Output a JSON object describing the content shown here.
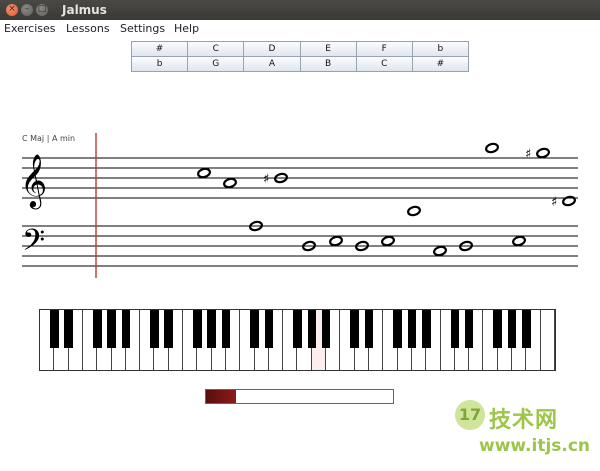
{
  "window": {
    "title": "Jalmus",
    "buttons": [
      "×",
      "–",
      "□"
    ]
  },
  "menu": [
    {
      "label": "Exercises"
    },
    {
      "label": "Lessons"
    },
    {
      "label": "Settings"
    },
    {
      "label": "Help"
    }
  ],
  "key_buttons": {
    "row1": [
      "#",
      "C",
      "D",
      "E",
      "F",
      "b"
    ],
    "row2": [
      "b",
      "G",
      "A",
      "B",
      "C",
      "#"
    ]
  },
  "staff": {
    "key_signature_label": "C Maj | A min",
    "cursor_color": "#c0392b",
    "treble_notes": [
      {
        "step": 1,
        "accidental": ""
      },
      {
        "step": -1,
        "accidental": ""
      },
      {
        "step": 0,
        "accidental": "♯"
      },
      {
        "step": 6,
        "accidental": ""
      },
      {
        "step": 5,
        "accidental": "♯"
      }
    ],
    "bass_notes": [
      {
        "step": 4,
        "accidental": ""
      },
      {
        "step": 0,
        "accidental": ""
      },
      {
        "step": 1,
        "accidental": ""
      },
      {
        "step": 0,
        "accidental": ""
      },
      {
        "step": 1,
        "accidental": ""
      },
      {
        "step": 7,
        "accidental": ""
      },
      {
        "step": -1,
        "accidental": ""
      },
      {
        "step": 0,
        "accidental": ""
      },
      {
        "step": 1,
        "accidental": ""
      },
      {
        "step": 9,
        "accidental": "♯"
      }
    ]
  },
  "piano": {
    "white_keys": 36,
    "highlighted_white_key": 19
  },
  "progress": {
    "value": 0.16
  },
  "watermark": {
    "logo_text": "17",
    "name": "技术网",
    "url": "www.itjs.cn"
  }
}
